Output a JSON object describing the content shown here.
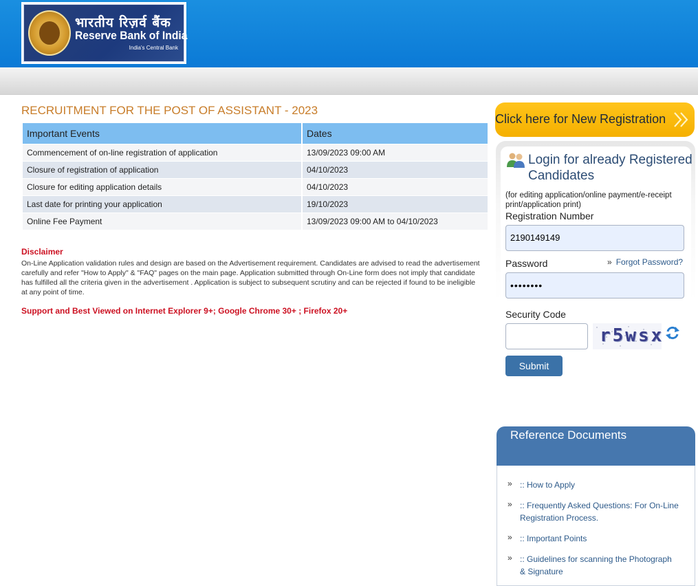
{
  "header": {
    "logo_hindi": "भारतीय रिज़र्व बैंक",
    "logo_english": "Reserve Bank of India",
    "logo_tagline": "India's Central Bank"
  },
  "main": {
    "title": "RECRUITMENT FOR THE POST OF ASSISTANT - 2023",
    "table": {
      "headers": [
        "Important Events",
        "Dates"
      ],
      "rows": [
        [
          "Commencement of on-line registration of application",
          "13/09/2023 09:00 AM"
        ],
        [
          "Closure of registration of application",
          "04/10/2023"
        ],
        [
          "Closure for editing application details",
          "04/10/2023"
        ],
        [
          "Last date for printing your application",
          "19/10/2023"
        ],
        [
          "Online Fee Payment",
          "13/09/2023 09:00 AM to 04/10/2023"
        ]
      ]
    },
    "disclaimer_title": "Disclaimer",
    "disclaimer_text": "On-Line Application validation rules and design are based on the Advertisement requirement. Candidates are advised to read the advertisement carefully and refer \"How to Apply\" & \"FAQ\" pages on the main page. Application submitted through On-Line form does not imply that candidate has fulfilled all the criteria given in the advertisement . Application is subject to subsequent scrutiny and can be rejected if found to be ineligible at any point of time.",
    "support_text": "Support and Best Viewed on Internet Explorer 9+; Google Chrome 30+ ; Firefox 20+"
  },
  "sidebar": {
    "new_registration_label": "Click here for New Registration",
    "login": {
      "title": "Login for already Registered Candidates",
      "note": "(for editing application/online payment/e-receipt print/application print)",
      "registration_label": "Registration Number",
      "registration_value": "2190149149",
      "password_label": "Password",
      "password_value": "••••••••",
      "forgot_label": "Forgot Password?",
      "security_label": "Security Code",
      "security_value": "",
      "captcha_text": "r5wsx",
      "submit_label": "Submit"
    },
    "reference": {
      "title": "Reference Documents",
      "items": [
        ":: How to Apply",
        ":: Frequently Asked Questions: For On-Line Registration Process.",
        ":: Important Points",
        ":: Guidelines for scanning the Photograph & Signature"
      ]
    }
  },
  "colors": {
    "header_blue": "#0b7ad6",
    "title_orange": "#c87d2a",
    "alert_red": "#cc1122",
    "new_reg_yellow": "#f5b000",
    "submit_blue": "#3b72a8",
    "reference_header_blue": "#4677ae"
  },
  "icons": [
    "users-icon",
    "double-chevron-right-icon",
    "refresh-icon"
  ]
}
